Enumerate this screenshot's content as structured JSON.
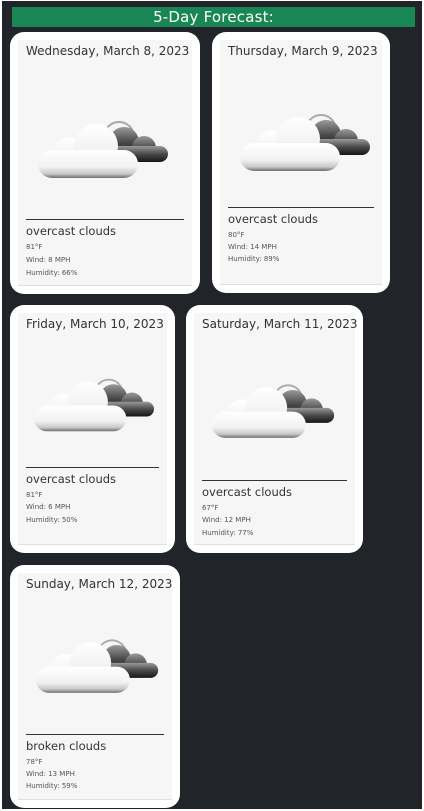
{
  "header": {
    "title": "5-Day Forecast:"
  },
  "forecast": [
    {
      "date": "Wednesday, March 8, 2023",
      "description": "overcast clouds",
      "temp": "81°F",
      "wind": "Wind: 8 MPH",
      "humidity": "Humidity: 66%",
      "icon": "overcast-clouds-icon"
    },
    {
      "date": "Thursday, March 9, 2023",
      "description": "overcast clouds",
      "temp": "80°F",
      "wind": "Wind: 14 MPH",
      "humidity": "Humidity: 89%",
      "icon": "overcast-clouds-icon"
    },
    {
      "date": "Friday, March 10, 2023",
      "description": "overcast clouds",
      "temp": "81°F",
      "wind": "Wind: 6 MPH",
      "humidity": "Humidity: 50%",
      "icon": "overcast-clouds-icon"
    },
    {
      "date": "Saturday, March 11, 2023",
      "description": "overcast clouds",
      "temp": "67°F",
      "wind": "Wind: 12 MPH",
      "humidity": "Humidity: 77%",
      "icon": "overcast-clouds-icon"
    },
    {
      "date": "Sunday, March 12, 2023",
      "description": "broken clouds",
      "temp": "78°F",
      "wind": "Wind: 13 MPH",
      "humidity": "Humidity: 59%",
      "icon": "broken-clouds-icon"
    }
  ],
  "colors": {
    "background": "#212529",
    "header": "#198754",
    "card": "#ffffff"
  }
}
